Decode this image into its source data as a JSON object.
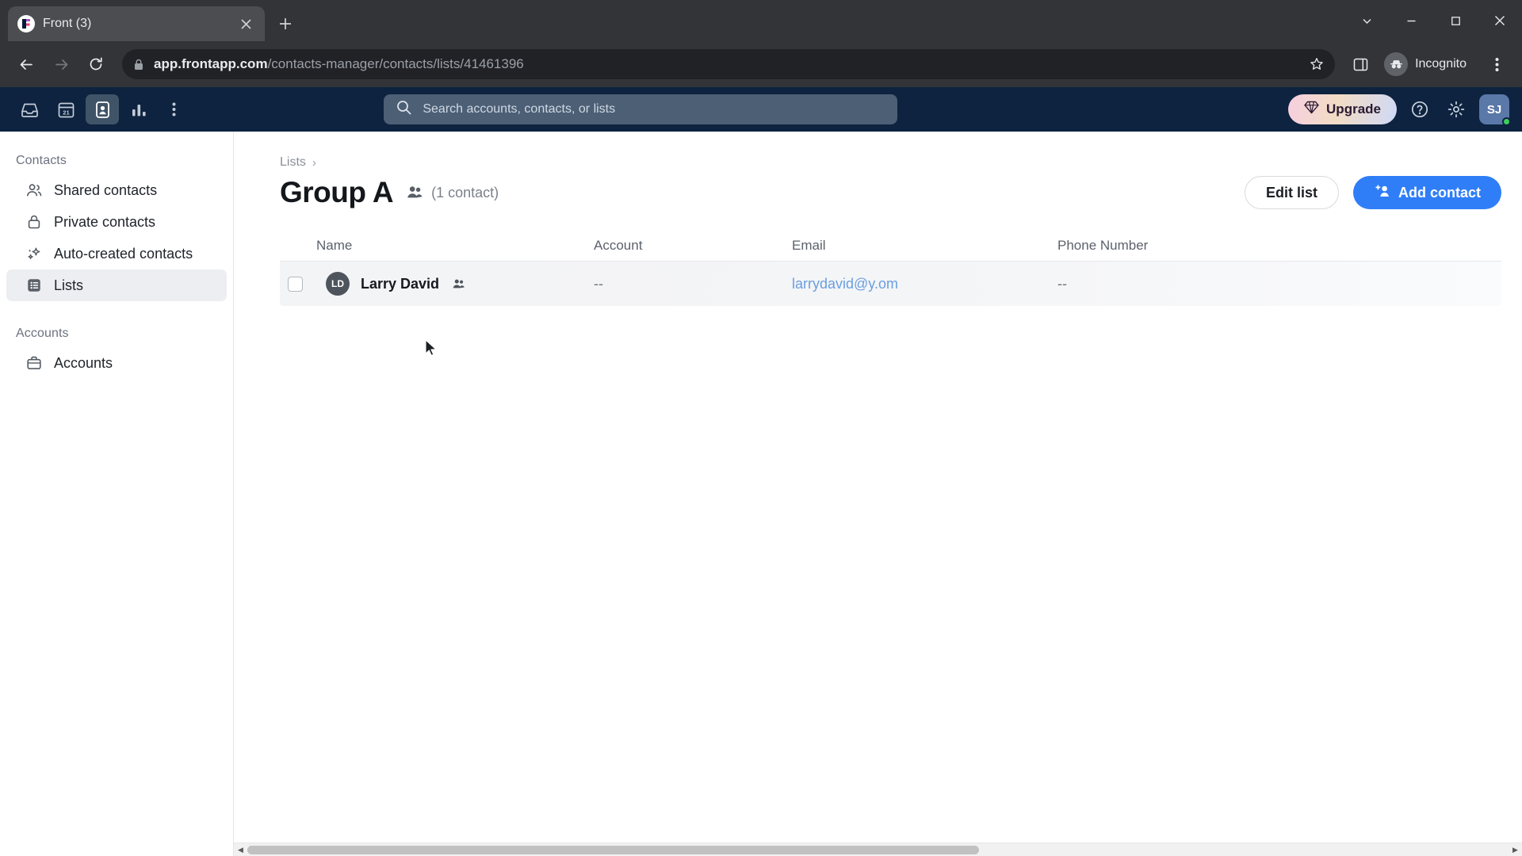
{
  "browser": {
    "tab": {
      "title": "Front (3)",
      "favicon_icon": "front-logo-icon",
      "close_icon": "close-icon"
    },
    "new_tab_icon": "plus-icon",
    "window_controls": {
      "minimize_icon": "chevron-down-icon",
      "restore_icon": "minimize-icon",
      "maximize_icon": "maximize-icon",
      "close_icon": "window-close-icon"
    },
    "nav": {
      "back_icon": "back-arrow-icon",
      "forward_icon": "forward-arrow-icon",
      "reload_icon": "reload-icon"
    },
    "omnibox": {
      "lock_icon": "lock-icon",
      "url_domain": "app.frontapp.com",
      "url_path": "/contacts-manager/contacts/lists/41461396",
      "bookmark_icon": "star-icon"
    },
    "side_panel_icon": "side-panel-icon",
    "incognito": {
      "label": "Incognito",
      "icon": "incognito-icon"
    },
    "menu_icon": "kebab-menu-icon"
  },
  "appbar": {
    "nav_items": [
      {
        "name": "inbox",
        "icon": "inbox-icon",
        "active": false
      },
      {
        "name": "calendar",
        "icon": "calendar-icon",
        "active": false
      },
      {
        "name": "contacts",
        "icon": "contact-card-icon",
        "active": true
      },
      {
        "name": "analytics",
        "icon": "bar-chart-icon",
        "active": false
      }
    ],
    "more_icon": "kebab-menu-icon",
    "search": {
      "placeholder": "Search accounts, contacts, or lists",
      "icon": "search-icon"
    },
    "upgrade": {
      "label": "Upgrade",
      "icon": "diamond-icon"
    },
    "help_icon": "help-circle-icon",
    "settings_icon": "gear-icon",
    "avatar": {
      "initials": "SJ",
      "presence": "online"
    },
    "accent_colors": {
      "appbar_bg": "#0d2340",
      "primary": "#2f7ef7",
      "presence": "#3ecf5c"
    }
  },
  "sidebar": {
    "sections": [
      {
        "label": "Contacts",
        "items": [
          {
            "label": "Shared contacts",
            "icon": "people-icon",
            "active": false
          },
          {
            "label": "Private contacts",
            "icon": "lock-icon",
            "active": false
          },
          {
            "label": "Auto-created contacts",
            "icon": "sparkle-icon",
            "active": false
          },
          {
            "label": "Lists",
            "icon": "list-icon",
            "active": true
          }
        ]
      },
      {
        "label": "Accounts",
        "items": [
          {
            "label": "Accounts",
            "icon": "briefcase-icon",
            "active": false
          }
        ]
      }
    ]
  },
  "main": {
    "breadcrumb": {
      "label": "Lists",
      "separator": "›"
    },
    "title": "Group A",
    "title_icon": "people-icon",
    "count": "(1 contact)",
    "edit_list_label": "Edit list",
    "add_contact_label": "Add contact",
    "add_contact_icon": "add-person-icon",
    "table": {
      "columns": [
        "Name",
        "Account",
        "Email",
        "Phone Number"
      ],
      "rows": [
        {
          "initials": "LD",
          "name": "Larry David",
          "name_badge_icon": "people-icon",
          "account": "--",
          "email": "larrydavid@y.om",
          "phone": "--"
        }
      ]
    }
  },
  "scrollbar": {
    "left_arrow": "◀",
    "right_arrow": "▶"
  }
}
